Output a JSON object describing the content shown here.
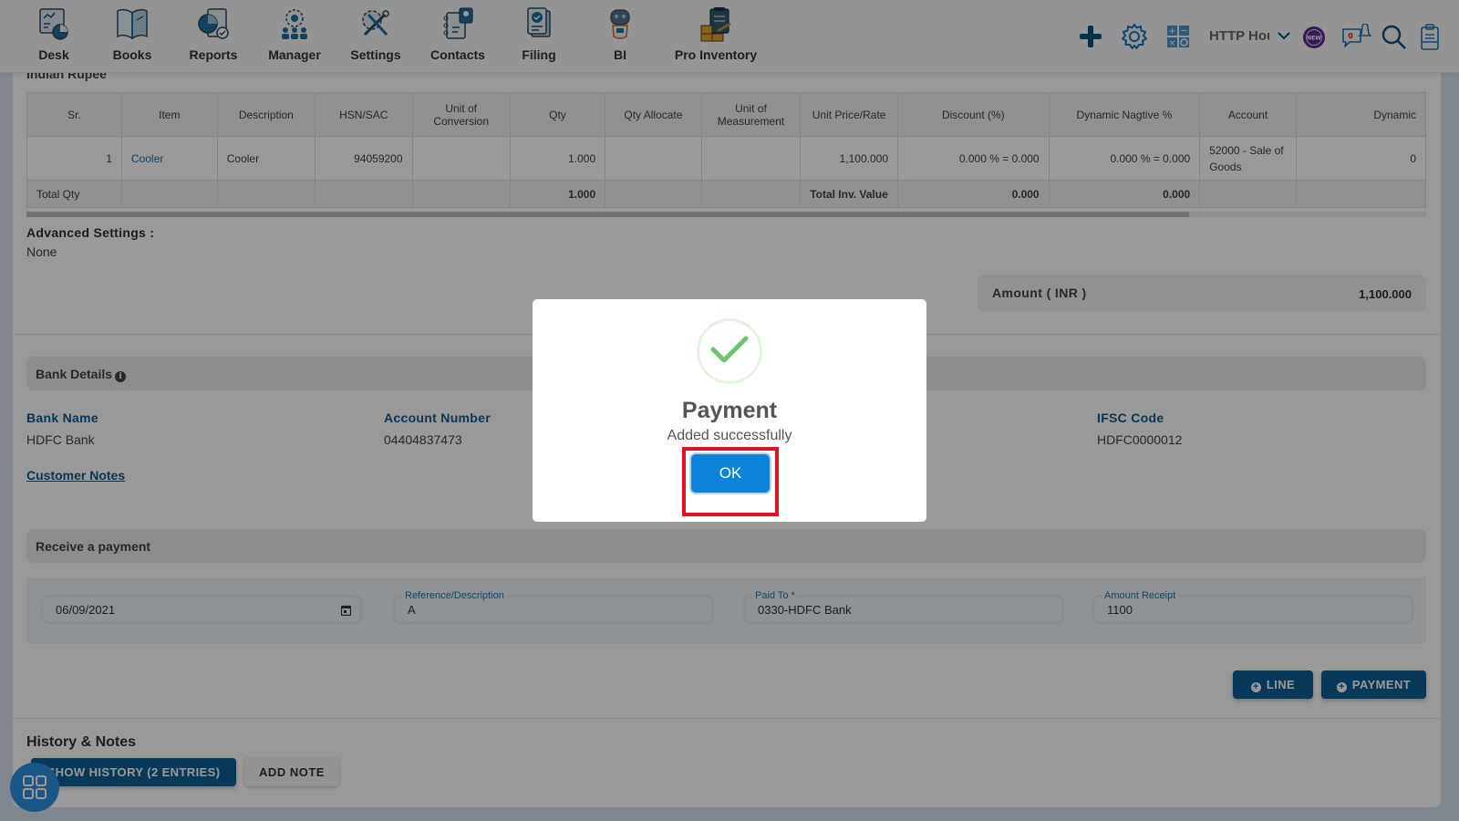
{
  "nav": {
    "items": [
      {
        "label": "Desk",
        "icon": "desk-icon"
      },
      {
        "label": "Books",
        "icon": "books-icon"
      },
      {
        "label": "Reports",
        "icon": "reports-icon"
      },
      {
        "label": "Manager",
        "icon": "manager-icon"
      },
      {
        "label": "Settings",
        "icon": "settings-icon"
      },
      {
        "label": "Contacts",
        "icon": "contacts-icon"
      },
      {
        "label": "Filing",
        "icon": "filing-icon"
      },
      {
        "label": "BI",
        "icon": "bi-robot-icon"
      },
      {
        "label": "Pro Inventory",
        "icon": "pro-inventory-icon"
      }
    ],
    "company": "HTTP Hou",
    "new_badge": "NEW",
    "notification_count": "0"
  },
  "invoice": {
    "currency": "Indian Rupee",
    "table": {
      "headers": [
        "Sr.",
        "Item",
        "Description",
        "HSN/SAC",
        "Unit of Conversion",
        "Qty",
        "Qty Allocate",
        "Unit of Measurement",
        "Unit Price/Rate",
        "Discount (%)",
        "Dynamic Nagtive %",
        "Account",
        "Dynamic"
      ],
      "rows": [
        {
          "sr": "1",
          "item": "Cooler",
          "description": "Cooler",
          "hsn": "94059200",
          "unit_conversion": "",
          "qty": "1.000",
          "qty_allocate": "",
          "uom": "",
          "rate": "1,100.000",
          "discount": "0.000 % = 0.000",
          "dynamic_negative": "0.000 % = 0.000",
          "account": "52000 - Sale of Goods",
          "dynamic": "0"
        }
      ],
      "totals": {
        "label": "Total Qty",
        "qty": "1.000",
        "inv_label": "Total Inv. Value",
        "discount_total": "0.000",
        "dynamic_total": "0.000"
      }
    },
    "advanced_settings_label": "Advanced Settings :",
    "advanced_settings_value": "None",
    "amount_label": "Amount ( INR )",
    "amount_value": "1,100.000"
  },
  "bank": {
    "section_title": "Bank Details",
    "bank_name_label": "Bank Name",
    "bank_name": "HDFC Bank",
    "account_number_label": "Account Number",
    "account_number": "04404837473",
    "ifsc_label": "IFSC Code",
    "ifsc": "HDFC0000012",
    "customer_notes": "Customer Notes"
  },
  "payment": {
    "section_title": "Receive a payment",
    "date": "06/09/2021",
    "reference_label": "Reference/Description",
    "reference": "A",
    "paid_to_label": "Paid To *",
    "paid_to": "0330-HDFC Bank",
    "amount_label": "Amount Receipt",
    "amount": "1100",
    "line_button": "LINE",
    "payment_button": "PAYMENT"
  },
  "history": {
    "title": "History & Notes",
    "show_history_button": "SHOW HISTORY (2 ENTRIES)",
    "add_note_button": "ADD NOTE"
  },
  "modal": {
    "title": "Payment",
    "message": "Added successfully",
    "ok_button": "OK"
  },
  "colors": {
    "primary": "#0b5f95",
    "ok_button": "#0b84d8",
    "highlight": "#e0141e",
    "success": "#6cc56c"
  }
}
